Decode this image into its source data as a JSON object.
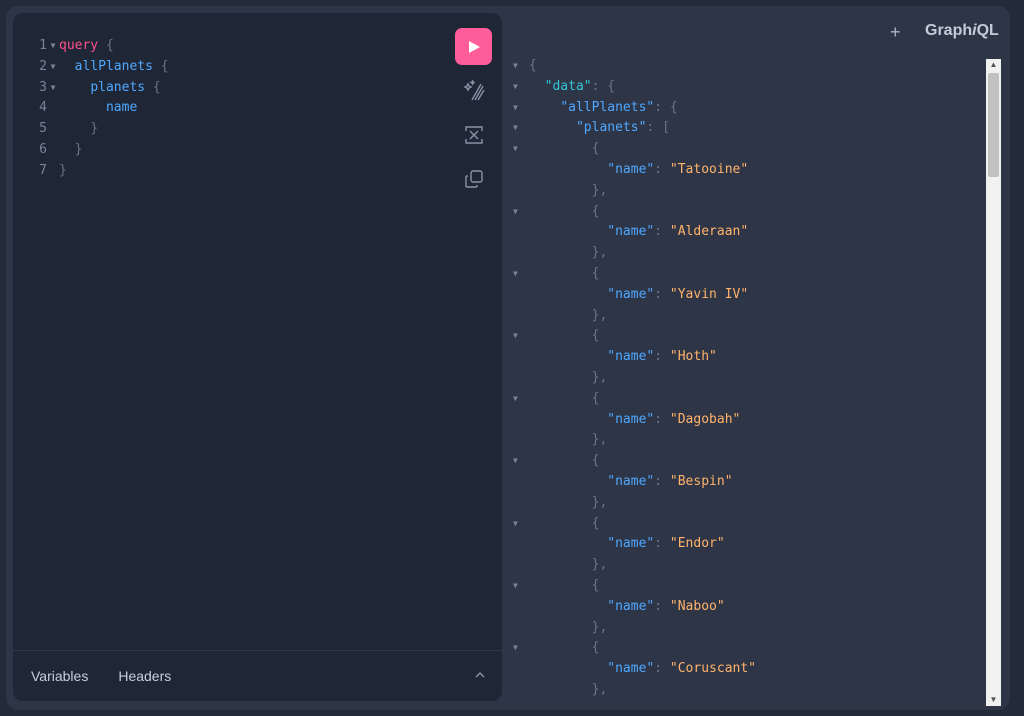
{
  "header": {
    "plus": "+",
    "brand_pre": "Graph",
    "brand_i": "i",
    "brand_post": "QL"
  },
  "editor": {
    "lines": [
      {
        "n": "1",
        "fold": true,
        "indent": "",
        "parts": [
          {
            "c": "kw",
            "t": "query"
          },
          {
            "c": "pun",
            "t": " {"
          }
        ]
      },
      {
        "n": "2",
        "fold": true,
        "indent": "  ",
        "parts": [
          {
            "c": "fld",
            "t": "allPlanets"
          },
          {
            "c": "pun",
            "t": " {"
          }
        ]
      },
      {
        "n": "3",
        "fold": true,
        "indent": "    ",
        "parts": [
          {
            "c": "fld",
            "t": "planets"
          },
          {
            "c": "pun",
            "t": " {"
          }
        ]
      },
      {
        "n": "4",
        "fold": false,
        "indent": "      ",
        "parts": [
          {
            "c": "fld",
            "t": "name"
          }
        ]
      },
      {
        "n": "5",
        "fold": false,
        "indent": "    ",
        "parts": [
          {
            "c": "pun",
            "t": "}"
          }
        ]
      },
      {
        "n": "6",
        "fold": false,
        "indent": "  ",
        "parts": [
          {
            "c": "pun",
            "t": "}"
          }
        ]
      },
      {
        "n": "7",
        "fold": false,
        "indent": "",
        "parts": [
          {
            "c": "pun",
            "t": "}"
          }
        ]
      }
    ],
    "tabs": {
      "variables": "Variables",
      "headers": "Headers"
    }
  },
  "result": {
    "planets": [
      "Tatooine",
      "Alderaan",
      "Yavin IV",
      "Hoth",
      "Dagobah",
      "Bespin",
      "Endor",
      "Naboo",
      "Coruscant"
    ],
    "keys": {
      "data": "\"data\"",
      "allPlanets": "\"allPlanets\"",
      "planets": "\"planets\"",
      "name": "\"name\""
    }
  }
}
